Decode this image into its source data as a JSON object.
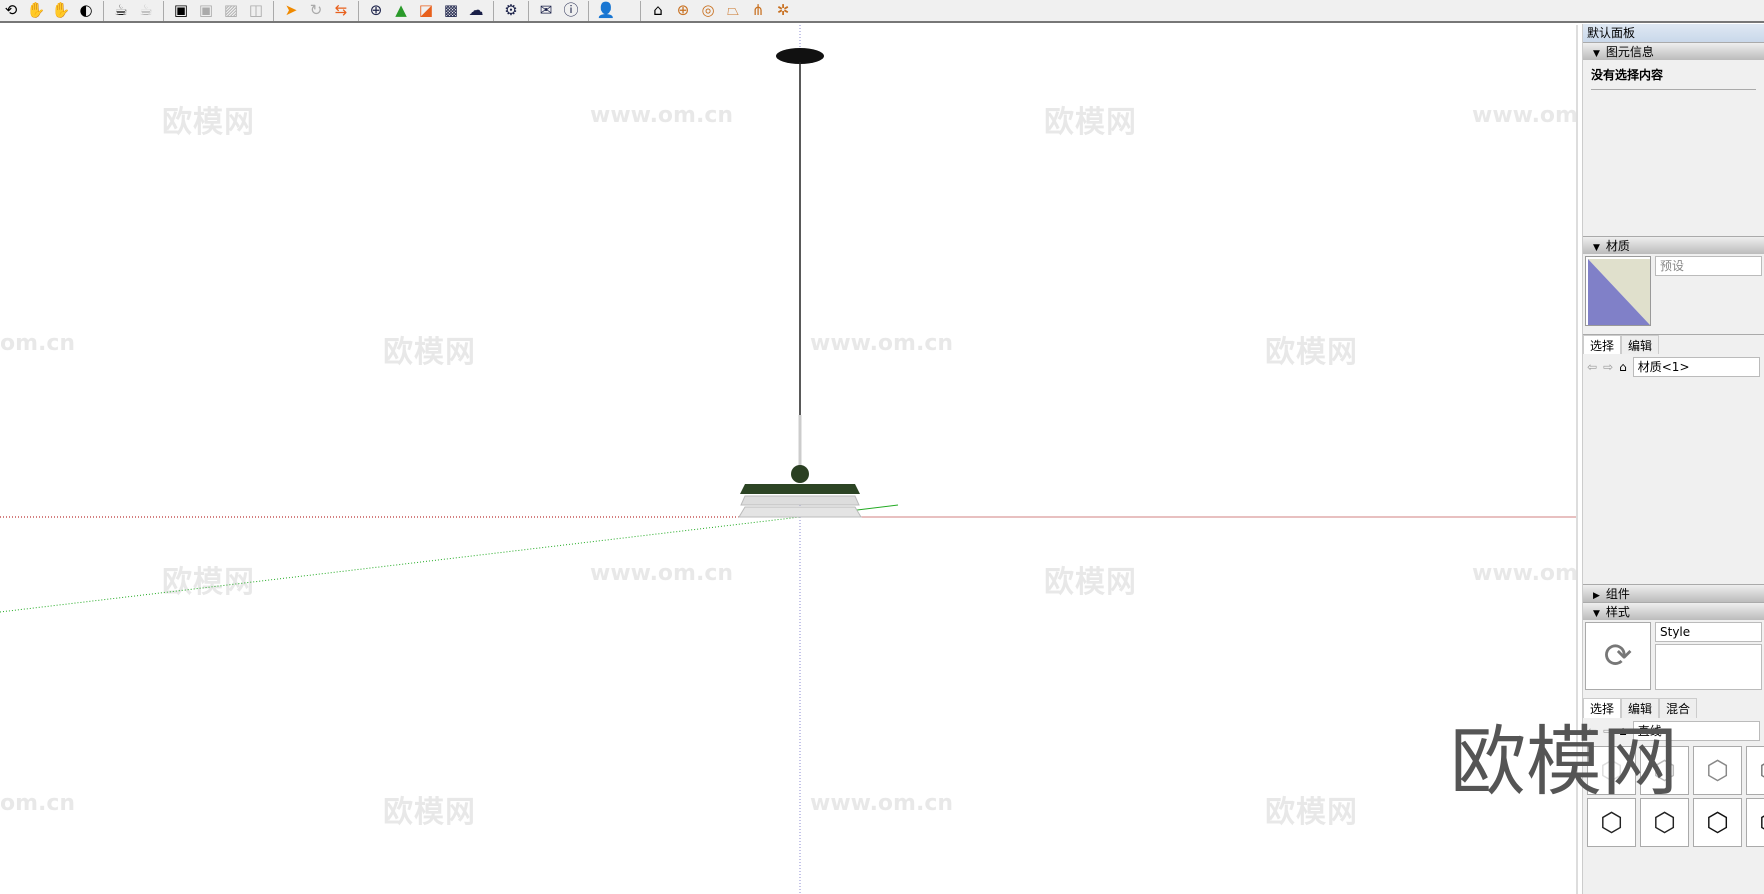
{
  "toolbar": {
    "icons": [
      "orbit-icon",
      "pan-icon",
      "zoom-icon",
      "zoom-extents-icon",
      "previous-view-icon",
      "position-camera-icon",
      "walk-icon",
      "section-plane-icon",
      "display-section-icon",
      "iso-view-icon",
      "top-view-icon",
      "front-view-icon",
      "right-view-icon",
      "follow-me-icon",
      "rotate-icon",
      "flip-icon",
      "add-location-icon",
      "get-models-icon",
      "share-model-icon",
      "texture-icon",
      "upload-icon",
      "extension-settings-icon",
      "mail-icon",
      "info-icon",
      "user-icon",
      "sandbox-icon",
      "stamp-icon",
      "drape-icon",
      "smoove-icon",
      "add-detail-icon",
      "flip-edge-icon"
    ]
  },
  "watermarks": {
    "logo": "欧模网",
    "url": "www.om.cn",
    "partial_url": "om.cn"
  },
  "panel": {
    "title": "默认面板",
    "entity_info": {
      "header": "图元信息",
      "status": "没有选择内容"
    },
    "materials": {
      "header": "材质",
      "name_placeholder": "预设",
      "tabs": [
        "选择",
        "编辑"
      ],
      "collection": "材质<1>",
      "swatch_colors": [
        "#8080c8",
        "#e0e0cc"
      ]
    },
    "components": {
      "header": "组件"
    },
    "styles": {
      "header": "样式",
      "name": "Style",
      "tabs": [
        "选择",
        "编辑",
        "混合"
      ],
      "collection": "直线"
    }
  }
}
